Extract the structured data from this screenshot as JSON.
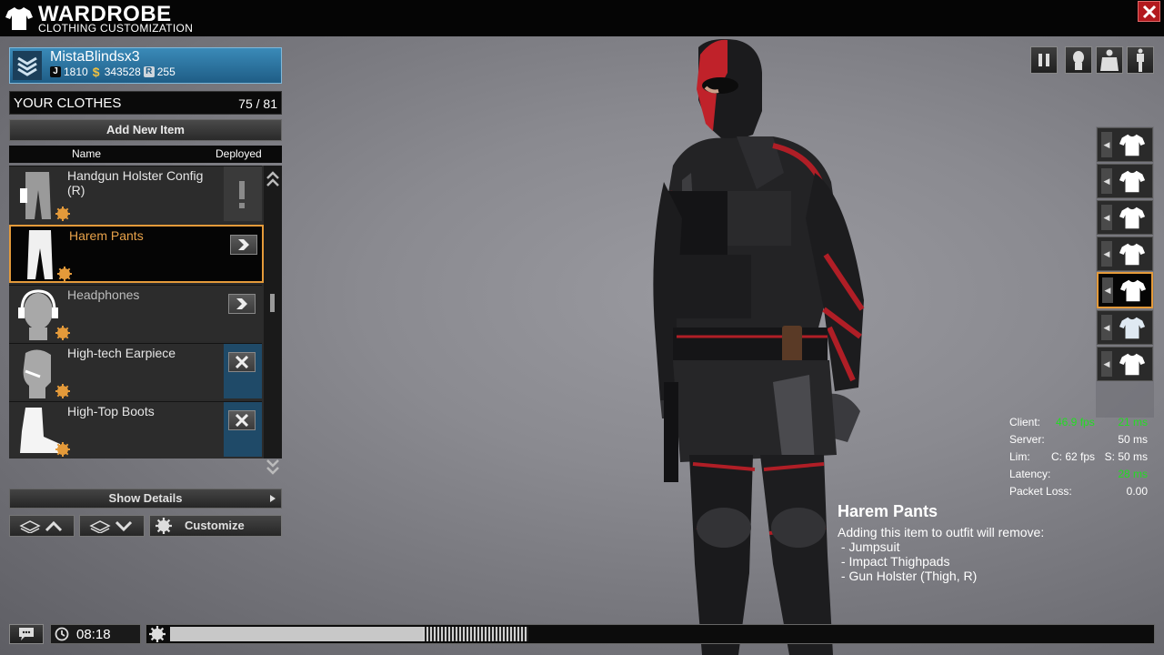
{
  "window": {
    "title": "WARDROBE",
    "subtitle": "CLOTHING CUSTOMIZATION"
  },
  "profile": {
    "name": "MistaBlindsx3",
    "joule": "1810",
    "cash": "343528",
    "reward": "255"
  },
  "clothes": {
    "title": "YOUR CLOTHES",
    "count": "75 / 81",
    "add_label": "Add New Item",
    "col_name": "Name",
    "col_deployed": "Deployed",
    "items": [
      {
        "name": "Handgun Holster Config (R)",
        "state": "warning"
      },
      {
        "name": "Harem Pants",
        "state": "deploy"
      },
      {
        "name": "Headphones",
        "state": "deploy"
      },
      {
        "name": "High-tech Earpiece",
        "state": "remove"
      },
      {
        "name": "High-Top Boots",
        "state": "remove"
      }
    ],
    "show_details": "Show Details",
    "customize": "Customize"
  },
  "stats": {
    "client_label": "Client:",
    "client_fps": "46.9 fps",
    "client_ms": "21 ms",
    "server_label": "Server:",
    "server_val": "50 ms",
    "lim_label": "Lim:",
    "lim_c": "C: 62 fps",
    "lim_s": "S: 50 ms",
    "latency_label": "Latency:",
    "latency_val": "28 ms",
    "loss_label": "Packet Loss:",
    "loss_val": "0.00"
  },
  "tooltip": {
    "title": "Harem Pants",
    "intro": "Adding this item to outfit will remove:",
    "lines": [
      " - Jumpsuit",
      " - Impact Thighpads",
      " - Gun Holster (Thigh, R)"
    ]
  },
  "bottom": {
    "time": "08:18"
  },
  "colors": {
    "accent": "#e49a3a",
    "close": "#b3191e",
    "profile": "#2a74a3",
    "good": "#22dd22"
  }
}
